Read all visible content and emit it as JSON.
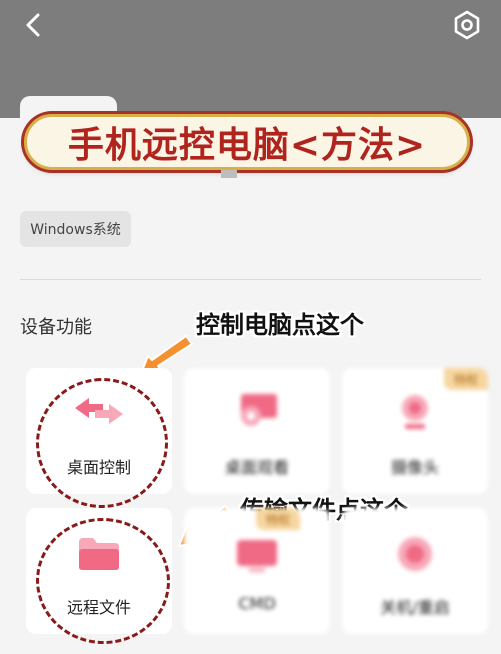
{
  "banner": {
    "title": "手机远控电脑<方法>"
  },
  "os_badge": "Windows系统",
  "section": {
    "title": "设备功能"
  },
  "annotations": {
    "desktop": "控制电脑点这个",
    "files": "传输文件点这个"
  },
  "cards": [
    {
      "label": "桌面控制",
      "vip": ""
    },
    {
      "label": "桌面观看",
      "vip": ""
    },
    {
      "label": "摄像头",
      "vip": "特权"
    },
    {
      "label": "远程文件",
      "vip": ""
    },
    {
      "label": "CMD",
      "vip": "特权"
    },
    {
      "label": "关机/重启",
      "vip": ""
    }
  ],
  "colors": {
    "header": "#7d7d7d",
    "banner_text": "#b0241e",
    "icon_pink": "#f06a86",
    "arrow_orange": "#f5902e",
    "circle": "#8a1a1a"
  },
  "icons": {
    "back": "chevron-left-icon",
    "settings": "hexagon-gear-icon",
    "arrow": "pointing-arrow-icon"
  }
}
